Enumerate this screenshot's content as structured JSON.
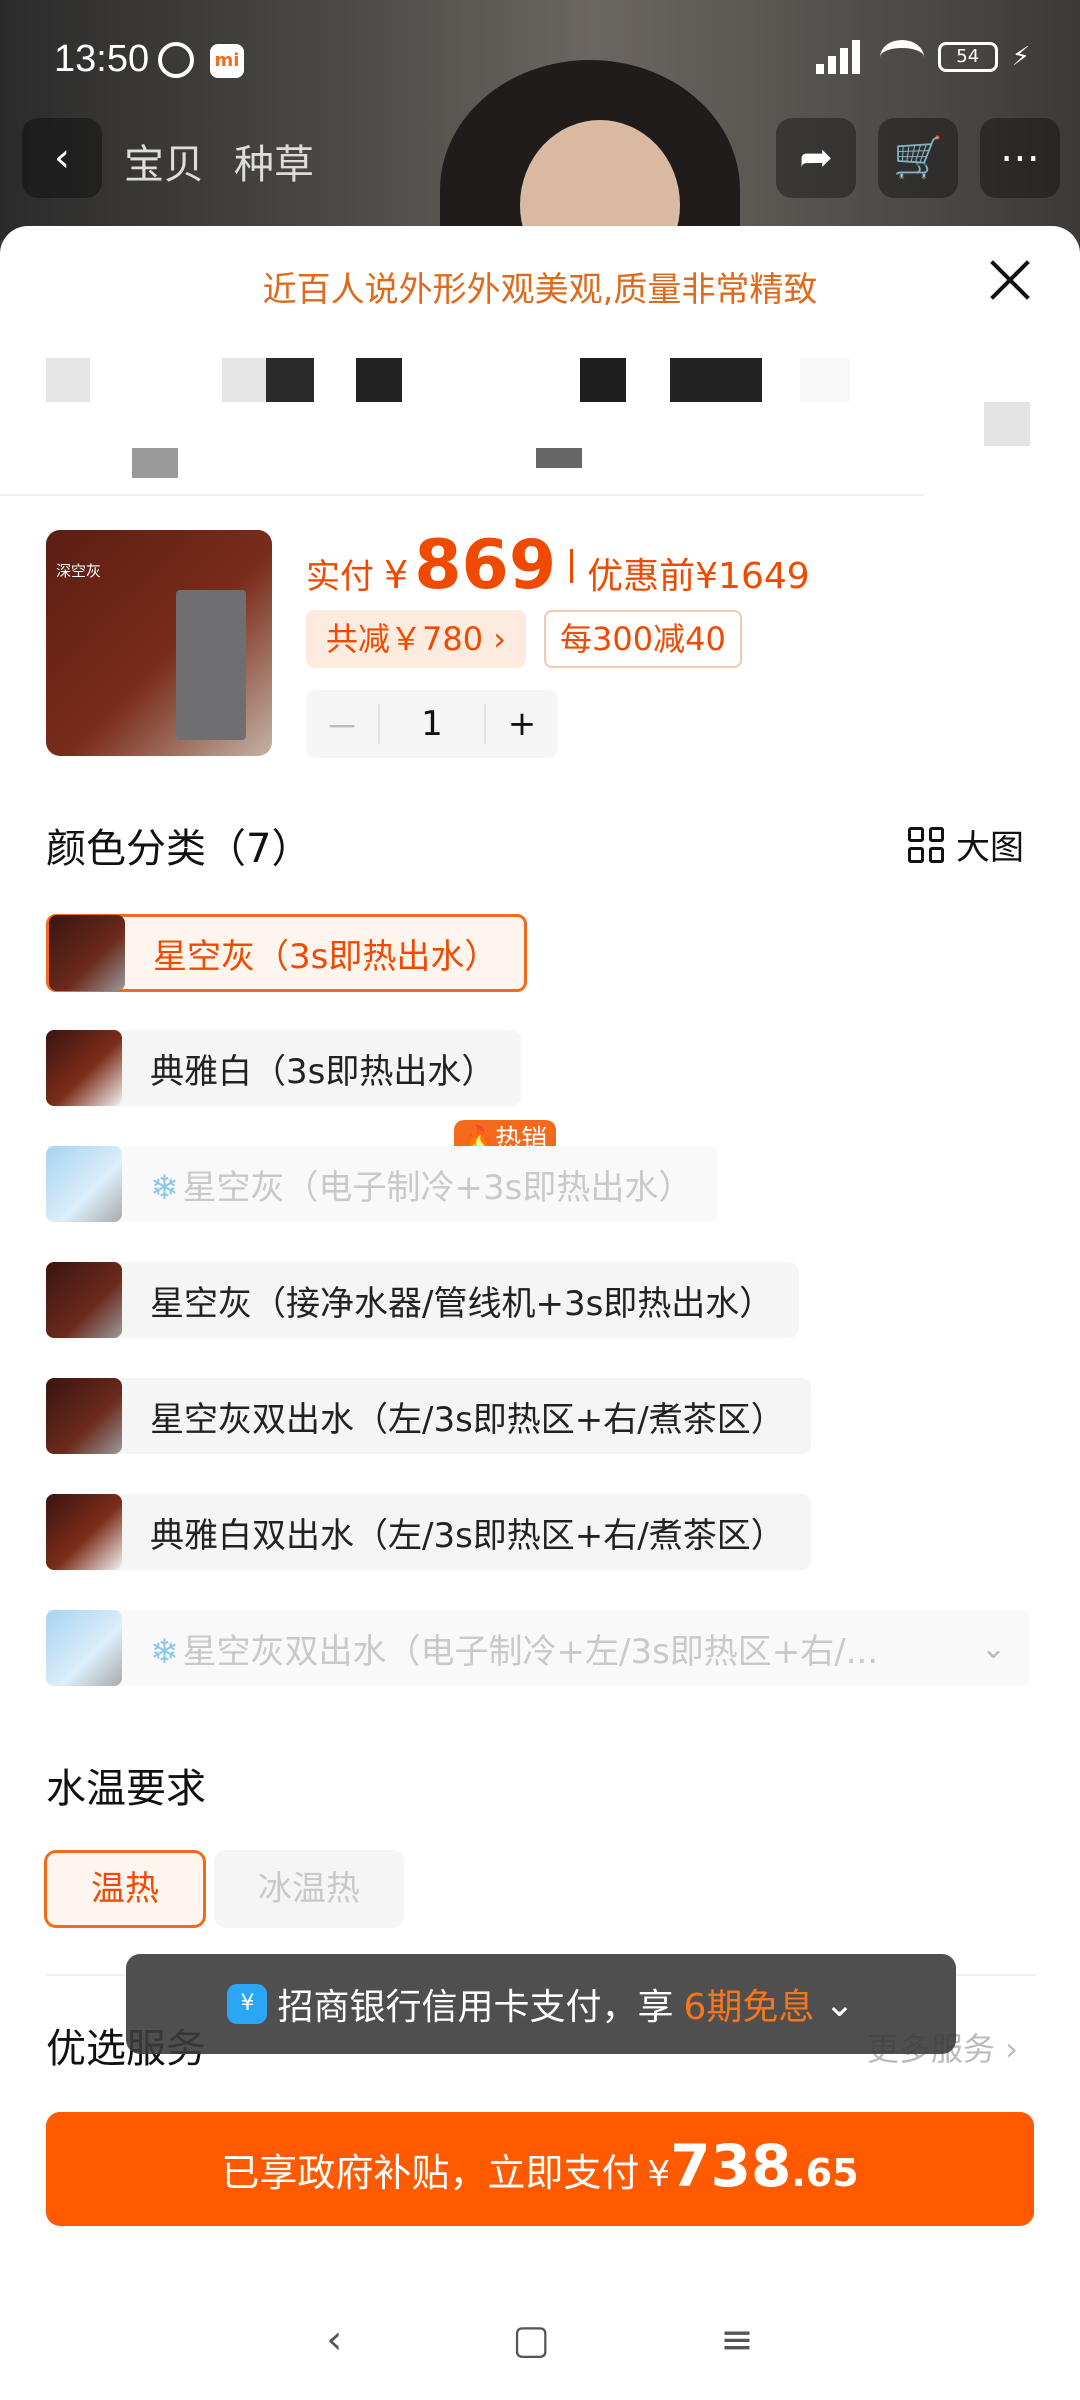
{
  "status_bar": {
    "time": "13:50",
    "battery": "54"
  },
  "top_nav": {
    "tab_product": "宝贝",
    "tab_grass": "种草"
  },
  "sheet": {
    "promo_text": "近百人说外形外观美观,质量非常精致",
    "product_label": "深空灰",
    "price": {
      "paid_label": "实付",
      "currency": "¥",
      "amount": "869",
      "before_label": "优惠前¥1649"
    },
    "discount_tag": "共减￥780 ›",
    "coupon_tag": "每300减40",
    "quantity": {
      "minus": "－",
      "value": "1",
      "plus": "+"
    },
    "color_section": {
      "title": "颜色分类（7）",
      "big_image": "大图"
    },
    "hot_badge": "🔥热销",
    "options": [
      {
        "label": "星空灰（3s即热出水）",
        "state": "selected"
      },
      {
        "label": "典雅白（3s即热出水）",
        "state": "normal"
      },
      {
        "label": "星空灰（电子制冷+3s即热出水）",
        "state": "disabled"
      },
      {
        "label": "星空灰（接净水器/管线机+3s即热出水）",
        "state": "normal"
      },
      {
        "label": "星空灰双出水（左/3s即热区+右/煮茶区）",
        "state": "normal"
      },
      {
        "label": "典雅白双出水（左/3s即热区+右/煮茶区）",
        "state": "normal"
      },
      {
        "label": "星空灰双出水（电子制冷+左/3s即热区+右/...",
        "state": "disabled"
      }
    ],
    "temp_section": {
      "title": "水温要求",
      "options": [
        "温热",
        "冰温热"
      ]
    },
    "service_section": {
      "title": "优选服务",
      "more": "更多服务 ›"
    },
    "toast": {
      "prefix": "招商银行信用卡支付，享",
      "highlight": "6期免息",
      "chevron": "⌄"
    },
    "pay_button": {
      "text": "已享政府补贴，立即支付",
      "currency": "¥",
      "int": "738",
      "dec": ".65"
    }
  },
  "colors": {
    "accent": "#ff5a00",
    "promo": "#e06a1b"
  }
}
